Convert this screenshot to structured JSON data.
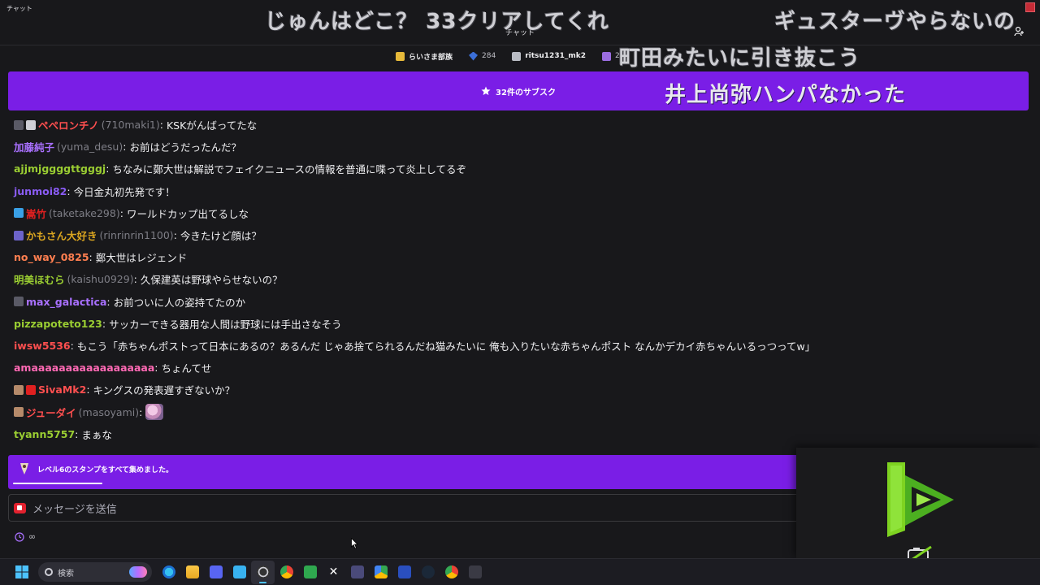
{
  "window": {
    "top_label": "チャット",
    "title": "チャット"
  },
  "leaderboard": [
    {
      "name": "らいさま部族",
      "icon": "gift-gold-icon"
    },
    {
      "name": "284",
      "icon": "bits-blue-icon"
    },
    {
      "name": "ritsu1231_mk2",
      "icon": "gift-silver-icon"
    },
    {
      "name": "2",
      "icon": "gift-purple-icon"
    }
  ],
  "sub_banner": {
    "text": "32件のサブスク",
    "color": "#7a1ee6"
  },
  "overlay_comments": [
    "じゅんはどこ？ 33クリアしてくれ",
    "ギュスターヴやらないの",
    "町田みたいに引き抜こう",
    "井上尚弥ハンパなかった"
  ],
  "messages": [
    {
      "user": "ペペロンチノ",
      "login": "(710maki1)",
      "color": "#ff4f4f",
      "text": "KSKがんばってたな",
      "badges": [
        "badge-gray",
        "badge-speaker"
      ]
    },
    {
      "user": "加藤純子",
      "login": "(yuma_desu)",
      "color": "#a970ff",
      "text": "お前はどうだったんだ？",
      "badges": []
    },
    {
      "user": "ajjmjggggttgggj",
      "login": "",
      "color": "#9acd32",
      "text": "ちなみに鄭大世は解説でフェイクニュースの情報を普通に喋って炎上してるぞ",
      "badges": []
    },
    {
      "user": "junmoi82",
      "login": "",
      "color": "#8a5cf6",
      "text": "今日金丸初先発です！",
      "badges": []
    },
    {
      "user": "嵩竹",
      "login": "(taketake298)",
      "color": "#e02020",
      "text": "ワールドカップ出てるしな",
      "badges": [
        "badge-blue"
      ]
    },
    {
      "user": "かもさん大好き",
      "login": "(rinrinrin1100)",
      "color": "#daa520",
      "text": "今きたけど顔は？",
      "badges": [
        "badge-purple"
      ]
    },
    {
      "user": "no_way_0825",
      "login": "",
      "color": "#ff7f50",
      "text": "鄭大世はレジェンド",
      "badges": []
    },
    {
      "user": "明美ほむら",
      "login": "(kaishu0929)",
      "color": "#9acd32",
      "text": "久保建英は野球やらせないの？",
      "badges": []
    },
    {
      "user": "max_galactica",
      "login": "",
      "color": "#a970ff",
      "text": "お前ついに人の姿持てたのか",
      "badges": [
        "badge-gray"
      ]
    },
    {
      "user": "pizzapoteto123",
      "login": "",
      "color": "#9acd32",
      "text": "サッカーできる器用な人間は野球には手出さなそう",
      "badges": []
    },
    {
      "user": "iwsw5536",
      "login": "",
      "color": "#ff4f4f",
      "text": "もこう「赤ちゃんポストって日本にあるの？あるんだ じゃあ捨てられるんだね猫みたいに 俺も入りたいな赤ちゃんポスト なんかデカイ赤ちゃんいるっつってw」",
      "badges": []
    },
    {
      "user": "amaaaaaaaaaaaaaaaaaa",
      "login": "",
      "color": "#ff69b4",
      "text": "ちょんてせ",
      "badges": []
    },
    {
      "user": "SivaMk2",
      "login": "",
      "color": "#ff4f4f",
      "text": "キングスの発表遅すぎないか？",
      "badges": [
        "badge-photo",
        "badge-red"
      ]
    },
    {
      "user": "ジューダイ",
      "login": "(masoyami)",
      "color": "#ff4f4f",
      "text": "",
      "badges": [
        "badge-photo"
      ],
      "emote": "pink-emote"
    },
    {
      "user": "tyann5757",
      "login": "",
      "color": "#9acd32",
      "text": "まぁな",
      "badges": []
    }
  ],
  "notification": {
    "text": "レベル6のスタンプをすべて集めました。"
  },
  "input": {
    "placeholder": "メッセージを送信"
  },
  "timer": {
    "text": "∞"
  },
  "taskbar": {
    "search_label": "検索",
    "apps": [
      "edge-icon",
      "folder-icon",
      "discord-icon",
      "notepad-icon",
      "obs-icon",
      "chrome-icon",
      "xbox-icon",
      "x-icon",
      "app-icon",
      "drive-icon",
      "snip-icon",
      "steam-icon",
      "chrome-icon-2",
      "terminal-icon"
    ]
  }
}
